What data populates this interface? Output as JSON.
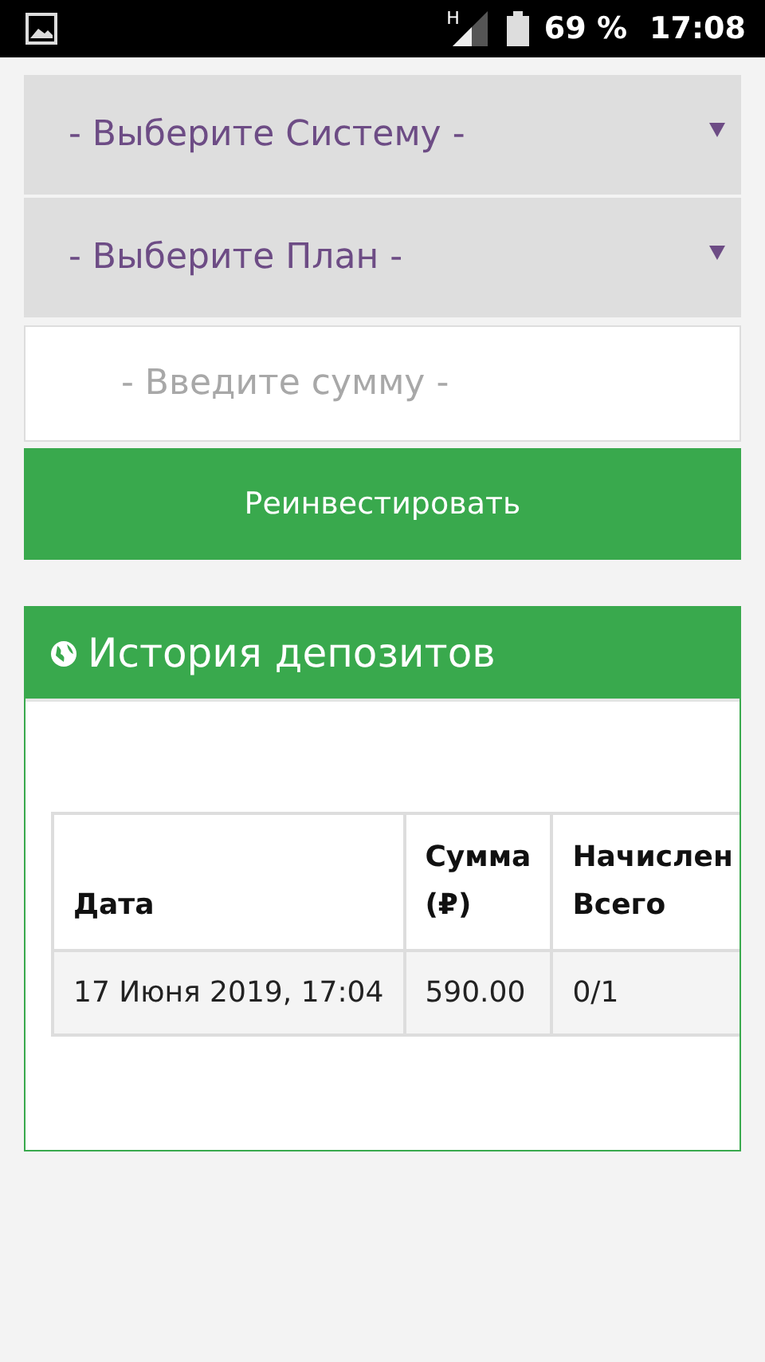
{
  "status_bar": {
    "network": "H",
    "battery": "69 %",
    "time": "17:08"
  },
  "form": {
    "selects": [
      {
        "placeholder": "- Выберите Систему -"
      },
      {
        "placeholder": "- Выберите План -"
      }
    ],
    "amount": {
      "placeholder": "- Введите сумму -"
    },
    "button": "Реинвестировать"
  },
  "panel": {
    "title": "История депозитов",
    "table": {
      "columns": [
        "Дата",
        "Сумма\n(₽)",
        "Начислен\nВсего"
      ],
      "rows": [
        [
          "17 Июня 2019, 17:04",
          "590.00",
          "0/1"
        ]
      ]
    }
  }
}
